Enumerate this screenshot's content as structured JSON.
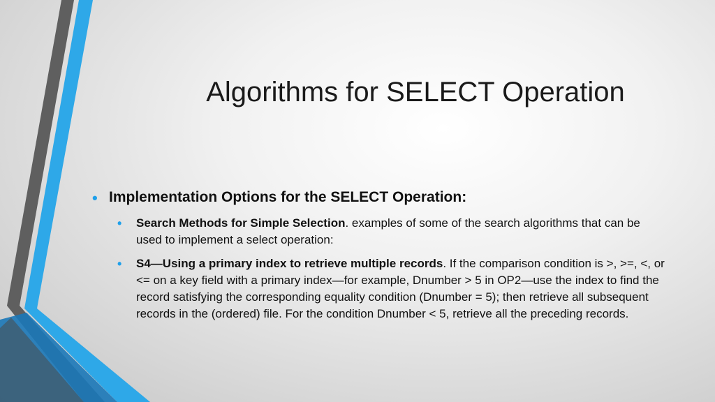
{
  "slide": {
    "title": "Algorithms for SELECT Operation",
    "bullet_symbol": "•",
    "bullet_color": "#1fa0ea",
    "level1": {
      "text": "Implementation Options for the SELECT Operation:"
    },
    "level2": [
      {
        "bold": "Search Methods for Simple Selection",
        "text": ". examples of some of the search algorithms that can be used to implement a select operation:"
      },
      {
        "bold": "S4—Using a primary index to retrieve multiple records",
        "text": ". If the comparison condition is >, >=, <, or <= on a key field with a primary index—for example, Dnumber > 5 in OP2—use the index to find the record satisfying the corresponding equality condition (Dnumber = 5); then retrieve all subsequent records in the (ordered) file. For the condition Dnumber < 5, retrieve all the preceding records."
      }
    ]
  },
  "theme": {
    "stripe_blue": "#2ea8e8",
    "stripe_gray": "#5f5f5f",
    "stripe_dark_blue": "#1b78b8"
  }
}
